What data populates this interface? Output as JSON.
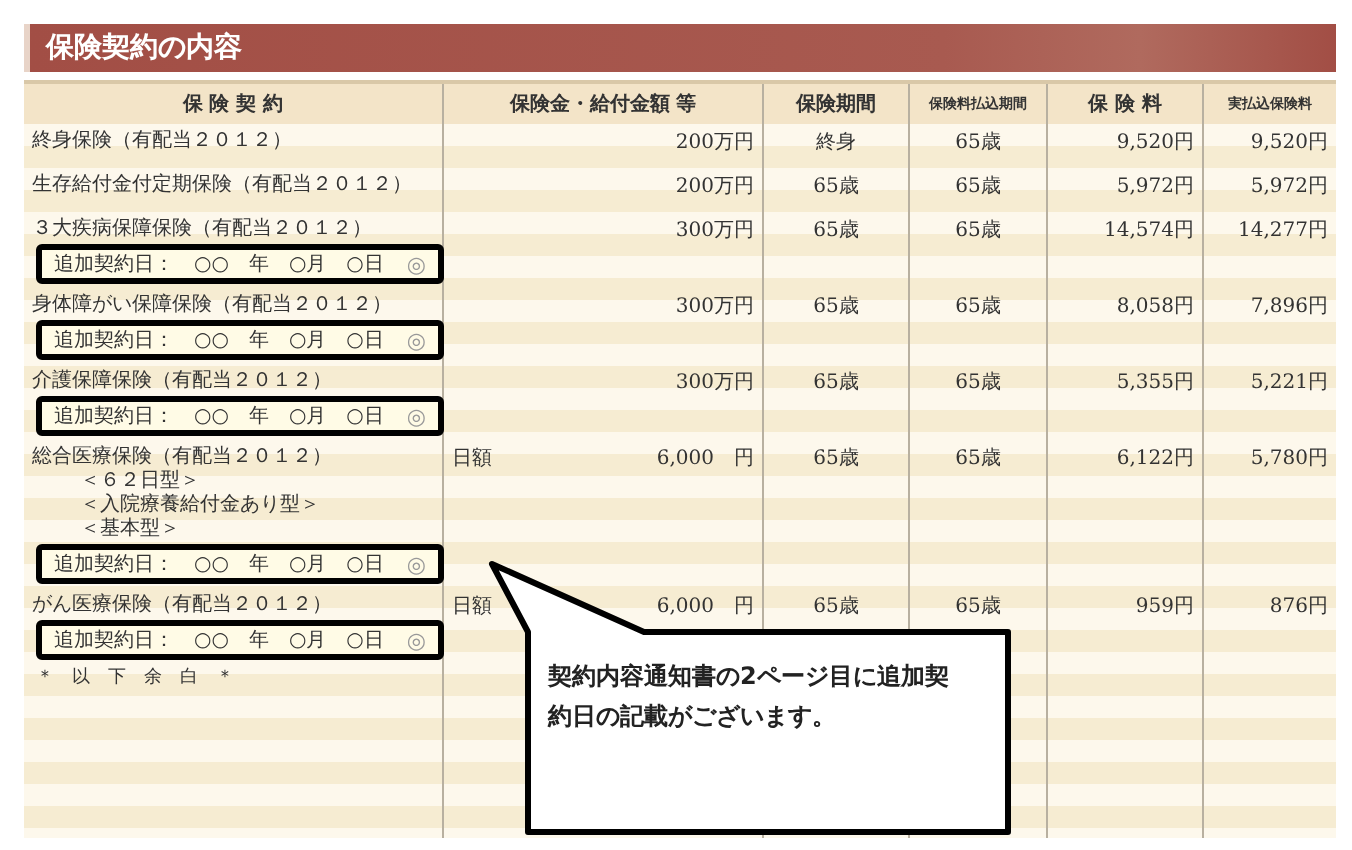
{
  "section_title": "保険契約の内容",
  "columns": [
    {
      "label": "保 険 契 約",
      "kind": "normal"
    },
    {
      "label": "保険金・給付金額 等",
      "kind": "normal"
    },
    {
      "label": "保険期間",
      "kind": "normal"
    },
    {
      "label": "保険料払込期間",
      "kind": "small"
    },
    {
      "label": "保 険 料",
      "kind": "normal"
    },
    {
      "label": "実払込保険料",
      "kind": "small"
    }
  ],
  "rows": [
    {
      "name": "終身保険（有配当２０１２）",
      "amount": {
        "value": "200万円"
      },
      "period": "終身",
      "payment_period": "65歳",
      "premium": "9,520円",
      "actual_premium": "9,520円"
    },
    {
      "name": "生存給付金付定期保険（有配当２０１２）",
      "amount": {
        "value": "200万円"
      },
      "period": "65歳",
      "payment_period": "65歳",
      "premium": "5,972円",
      "actual_premium": "5,972円"
    },
    {
      "name": "３大疾病保障保険（有配当２０１２）",
      "amount": {
        "value": "300万円"
      },
      "period": "65歳",
      "payment_period": "65歳",
      "premium": "14,574円",
      "actual_premium": "14,277円",
      "addendum": {
        "label": "追加契約日：",
        "date": "○○　年　○月　○日",
        "mark": "◎"
      }
    },
    {
      "name": "身体障がい保障保険（有配当２０１２）",
      "amount": {
        "value": "300万円"
      },
      "period": "65歳",
      "payment_period": "65歳",
      "premium": "8,058円",
      "actual_premium": "7,896円",
      "addendum": {
        "label": "追加契約日：",
        "date": "○○　年　○月　○日",
        "mark": "◎"
      }
    },
    {
      "name": "介護保障保険（有配当２０１２）",
      "amount": {
        "value": "300万円"
      },
      "period": "65歳",
      "payment_period": "65歳",
      "premium": "5,355円",
      "actual_premium": "5,221円",
      "addendum": {
        "label": "追加契約日：",
        "date": "○○　年　○月　○日",
        "mark": "◎"
      }
    },
    {
      "name": "総合医療保険（有配当２０１２）",
      "sub_lines": [
        "＜６２日型＞",
        "＜入院療養給付金あり型＞",
        "＜基本型＞"
      ],
      "amount": {
        "prefix": "日額",
        "value": "6,000　円"
      },
      "period": "65歳",
      "payment_period": "65歳",
      "premium": "6,122円",
      "actual_premium": "5,780円",
      "addendum": {
        "label": "追加契約日：",
        "date": "○○　年　○月　○日",
        "mark": "◎"
      }
    },
    {
      "name": "がん医療保険（有配当２０１２）",
      "amount": {
        "prefix": "日額",
        "value": "6,000　円"
      },
      "period": "65歳",
      "payment_period": "65歳",
      "premium": "959円",
      "actual_premium": "876円",
      "addendum": {
        "label": "追加契約日：",
        "date": "○○　年　○月　○日",
        "mark": "◎"
      }
    }
  ],
  "footer_note": "＊　以　下　余　白　＊",
  "callout": {
    "text": "契約内容通知書の2ページ目に追加契約日の記載がございます。"
  }
}
